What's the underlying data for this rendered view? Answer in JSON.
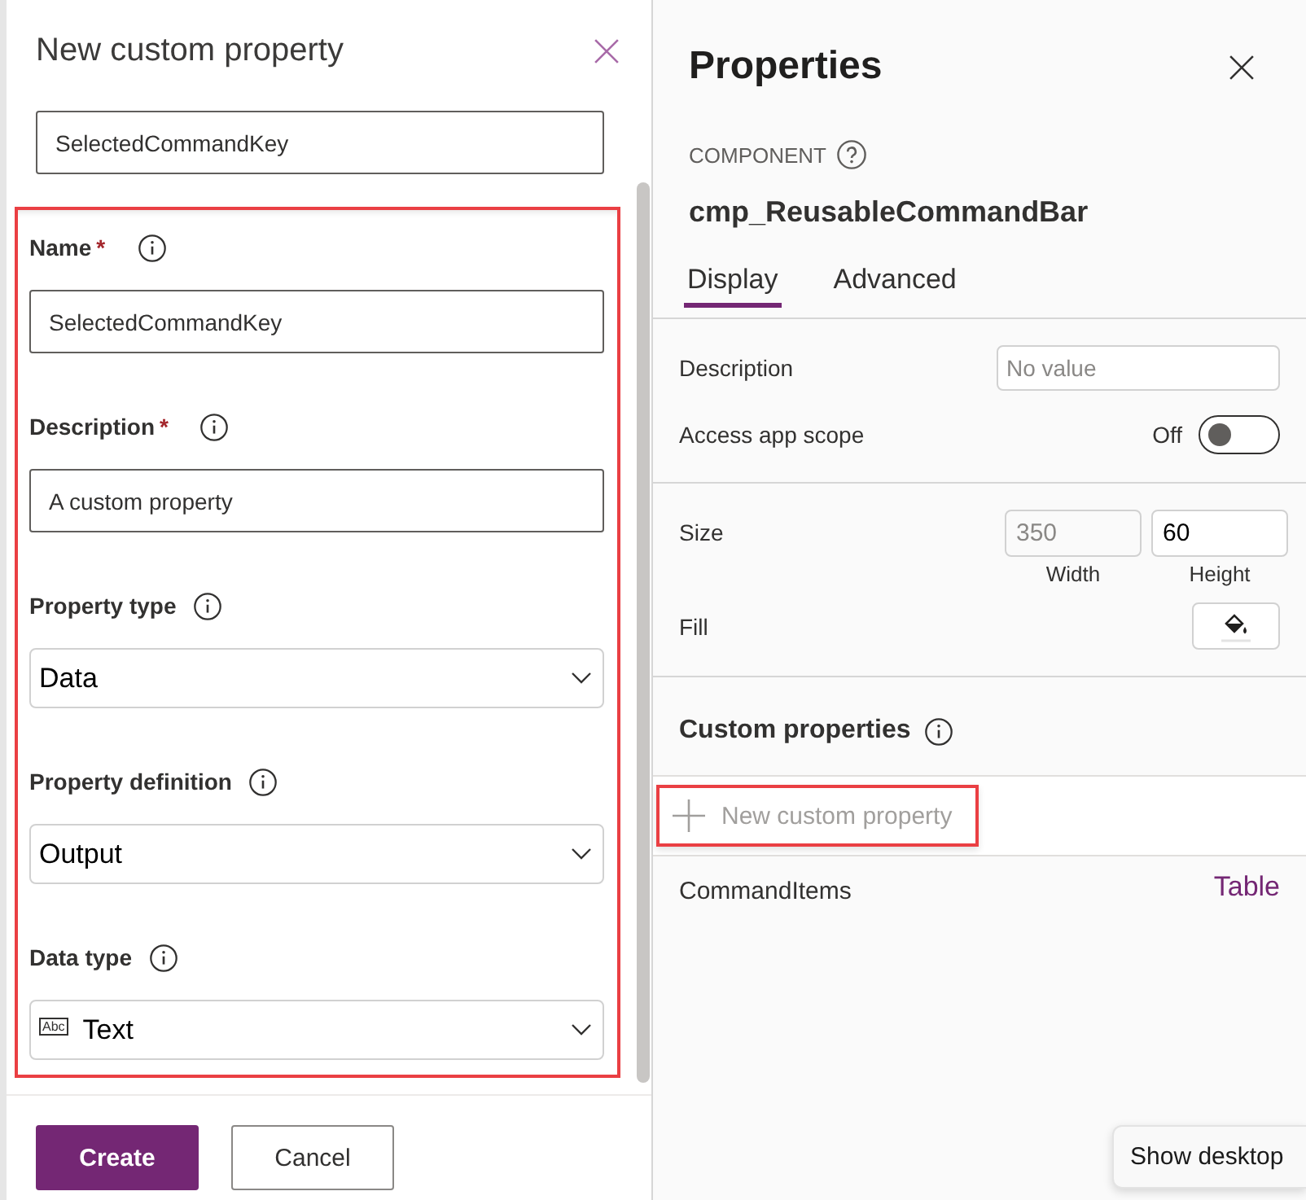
{
  "dialog": {
    "title": "New custom property",
    "top_field_value": "SelectedCommandKey",
    "form": {
      "highlighted": true,
      "fields": [
        {
          "label": "Name",
          "marker": "*",
          "kind": "text",
          "value": "SelectedCommandKey"
        },
        {
          "label": "Description",
          "marker": "*",
          "kind": "text",
          "value": "A custom property"
        },
        {
          "label": "Property type",
          "kind": "dropdown",
          "value": "Data"
        },
        {
          "label": "Property definition",
          "kind": "dropdown",
          "value": "Output"
        },
        {
          "label": "Data type",
          "kind": "dropdown",
          "value": "Text",
          "type_icon": "Abc"
        }
      ]
    },
    "buttons": [
      {
        "label": "Create",
        "kind": "primary"
      },
      {
        "label": "Cancel",
        "kind": "secondary"
      }
    ]
  },
  "properties": {
    "title": "Properties",
    "section_label": "COMPONENT",
    "component_name": "cmp_ReusableCommandBar",
    "tabs": [
      {
        "label": "Display",
        "selected": true
      },
      {
        "label": "Advanced",
        "selected": false
      }
    ],
    "description": {
      "label": "Description",
      "placeholder": "No value"
    },
    "access_app_scope": {
      "label": "Access app scope",
      "state_text": "Off",
      "on": false
    },
    "size": {
      "label": "Size",
      "fields": [
        {
          "value": "350",
          "caption": "Width",
          "disabled": true
        },
        {
          "value": "60",
          "caption": "Height",
          "disabled": false
        }
      ]
    },
    "fill": {
      "label": "Fill"
    },
    "custom_properties": {
      "title": "Custom properties",
      "new_button": {
        "label": "New custom property",
        "disabled": true,
        "highlighted": true
      },
      "items": [
        {
          "name": "CommandItems",
          "type": "Table"
        }
      ]
    }
  },
  "tooltip": {
    "text": "Show desktop"
  }
}
